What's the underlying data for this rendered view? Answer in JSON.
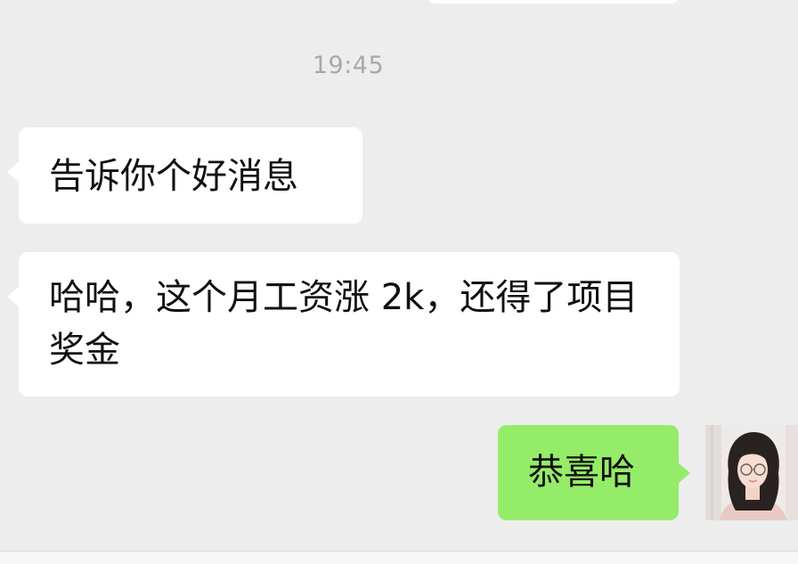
{
  "chat": {
    "timestamp": "19:45",
    "messages": [
      {
        "side": "left",
        "text": "告诉你个好消息"
      },
      {
        "side": "left",
        "text": "哈哈，这个月工资涨 2k，还得了项目奖金"
      },
      {
        "side": "right",
        "text": "恭喜哈"
      }
    ]
  },
  "colors": {
    "background": "#ededed",
    "incoming_bubble": "#ffffff",
    "outgoing_bubble": "#95ec69",
    "timestamp": "#a8a8a8"
  },
  "icons": {
    "self_avatar": "user-avatar-photo"
  }
}
